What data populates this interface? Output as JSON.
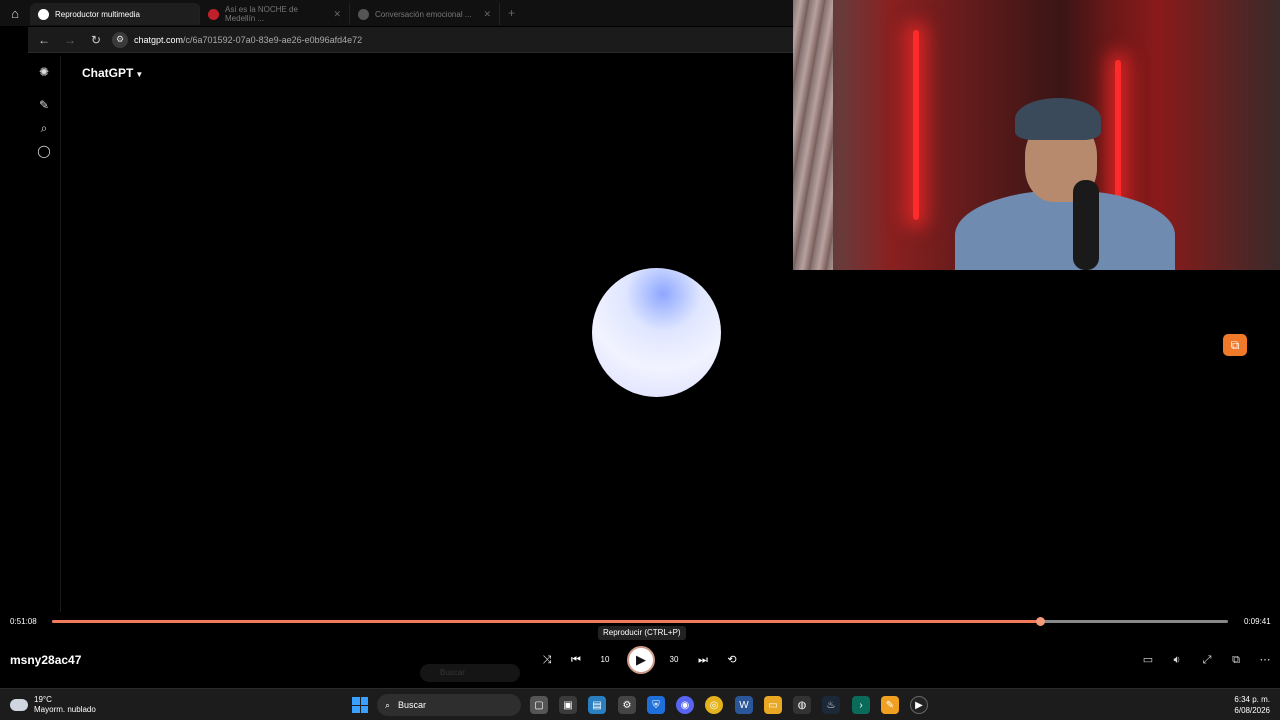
{
  "browser": {
    "tabs": [
      {
        "title": "Reproductor multimedia",
        "active": true
      },
      {
        "title": "Así es la NOCHE de Medellín ...",
        "active": false
      },
      {
        "title": "Conversación emocional ...",
        "active": false
      }
    ],
    "url_host": "chatgpt.com",
    "url_path": "/c/6a701592-07a0-83e9-ae26-e0b96afd4e72"
  },
  "chatgpt": {
    "model_label": "ChatGPT"
  },
  "player": {
    "elapsed": "0:51:08",
    "remaining": "0:09:41",
    "progress_fraction": 0.84,
    "tooltip": "Reproducir (CTRL+P)",
    "skip_back_label": "10",
    "skip_fwd_label": "30",
    "username": "msny28ac47"
  },
  "ghost_taskbar": {
    "search_label": "Buscar"
  },
  "taskbar": {
    "weather_temp": "19°C",
    "weather_desc": "Mayorm. nublado",
    "search_label": "Buscar",
    "time": "6:34 p. m.",
    "date": "6/08/2026"
  },
  "colors": {
    "accent": "#f07a5a",
    "float_button": "#f07a2a"
  }
}
